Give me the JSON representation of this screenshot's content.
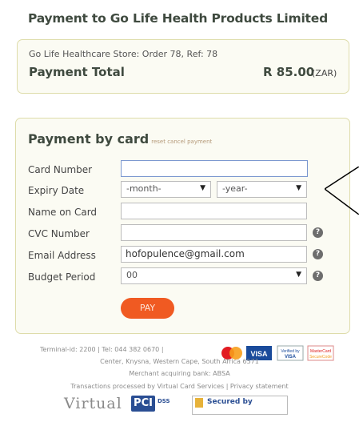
{
  "title": "Payment to Go Life Health Products Limited",
  "summary": {
    "order_line": "Go Life Healthcare Store: Order 78, Ref: 78",
    "total_label": "Payment Total",
    "amount": "R 85.00",
    "currency": "(ZAR)"
  },
  "card_form": {
    "title": "Payment by card",
    "links": "reset cancel payment",
    "fields": {
      "card_number": {
        "label": "Card Number",
        "value": ""
      },
      "expiry": {
        "label": "Expiry Date",
        "month": "-month-",
        "year": "-year-"
      },
      "name": {
        "label": "Name on Card",
        "value": ""
      },
      "cvc": {
        "label": "CVC Number",
        "value": ""
      },
      "email": {
        "label": "Email Address",
        "value": "hofopulence@gmail.com"
      },
      "budget": {
        "label": "Budget Period",
        "value": "00"
      }
    },
    "pay_button": "PAY"
  },
  "footer": {
    "line1": "Terminal-id: 2200 | Tel: 044 382 0670 |",
    "line2": "Center, Knysna, Western Cape, South Africa 6571",
    "line3": "Merchant acquiring bank: ABSA",
    "line4": "Transactions processed by Virtual Card Services | Privacy statement",
    "virtual_logo": "Virtual",
    "pci_logo": "PCI",
    "dss": "DSS",
    "secured": "Secured by",
    "verified_by": "Verified by VISA",
    "visa": "VISA",
    "securecode": "MasterCard SecureCode"
  },
  "colors": {
    "accent": "#f05a22",
    "panel_border": "#dedcaa",
    "panel_bg": "#fbfbf3"
  }
}
